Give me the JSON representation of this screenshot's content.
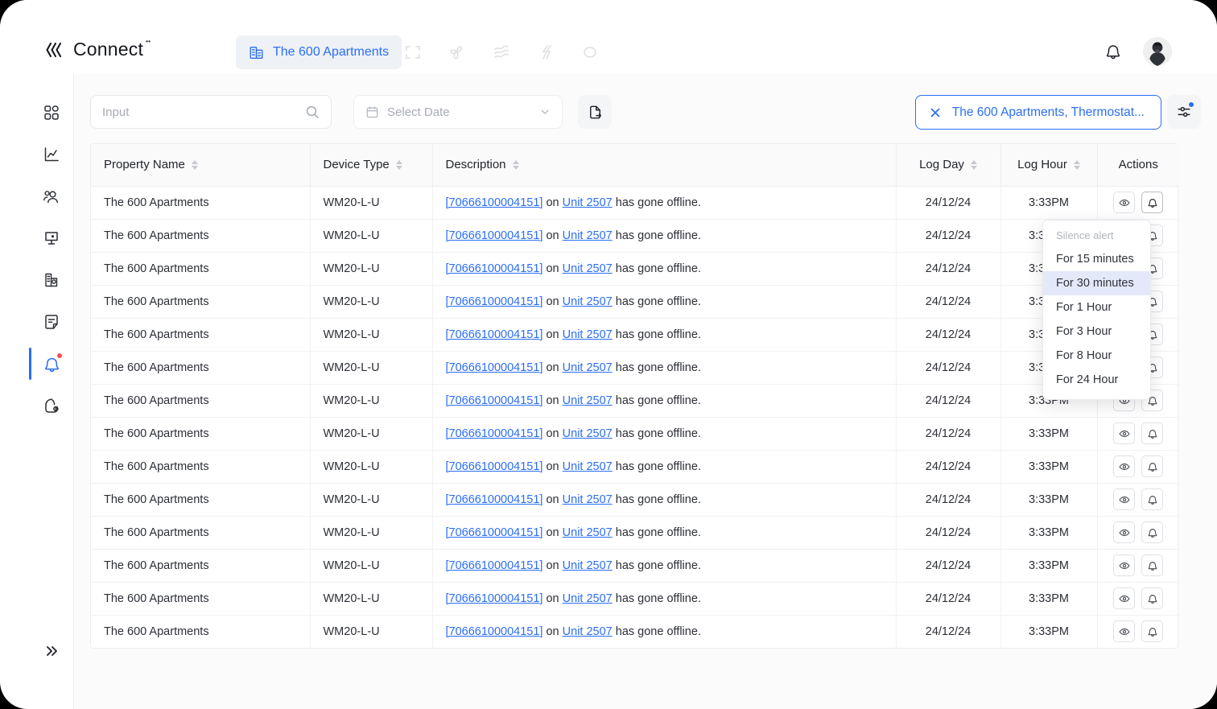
{
  "brand": {
    "name": "Connect",
    "tm": "TM"
  },
  "header": {
    "tab": {
      "label": "The 600 Apartments",
      "icon": "building-icon"
    },
    "nav_icons": [
      "expand-icon",
      "fan-icon",
      "waves-icon",
      "bolt-icon",
      "eye-shape-icon"
    ],
    "bell": "bell-icon",
    "avatar": "user-avatar"
  },
  "sidebar": {
    "items": [
      {
        "icon": "dashboard-grid-icon",
        "active": false
      },
      {
        "icon": "analytics-chart-icon",
        "active": false
      },
      {
        "icon": "users-icon",
        "active": false
      },
      {
        "icon": "monitor-device-icon",
        "active": false
      },
      {
        "icon": "building-report-icon",
        "active": false
      },
      {
        "icon": "document-note-icon",
        "active": false
      },
      {
        "icon": "bell-alert-icon",
        "active": true,
        "badge": true
      },
      {
        "icon": "billing-wallet-icon",
        "active": false
      }
    ],
    "collapse": {
      "icon": "chevron-double-right-icon"
    }
  },
  "toolbar": {
    "search": {
      "value": "",
      "placeholder": "Input",
      "icon": "search-icon"
    },
    "date": {
      "label": "Select Date",
      "icon": "calendar-icon",
      "chevron": "chevron-down-icon"
    },
    "export": {
      "icon": "export-document-icon"
    },
    "filter_chip": {
      "label": "The 600 Apartments, Thermostat...",
      "close_icon": "close-x-icon"
    },
    "settings": {
      "icon": "sliders-settings-icon",
      "badge": true
    }
  },
  "table": {
    "columns": [
      {
        "key": "property",
        "label": "Property Name",
        "sortable": true
      },
      {
        "key": "device",
        "label": "Device Type",
        "sortable": true
      },
      {
        "key": "description",
        "label": "Description",
        "sortable": true
      },
      {
        "key": "log_day",
        "label": "Log Day",
        "sortable": true
      },
      {
        "key": "log_hour",
        "label": "Log Hour",
        "sortable": true
      },
      {
        "key": "actions",
        "label": "Actions",
        "sortable": false
      }
    ],
    "row_template": {
      "property": "The 600 Apartments",
      "device": "WM20-L-U",
      "desc_id": "[70666100004151]",
      "desc_mid": " on ",
      "desc_unit": "Unit 2507",
      "desc_tail": " has gone offline.",
      "log_day": "24/12/24",
      "log_hour": "3:33PM"
    },
    "row_count": 14,
    "action_icons": {
      "view": "eye-icon",
      "silence": "bell-icon"
    }
  },
  "dropdown": {
    "title": "Silence alert",
    "items": [
      {
        "label": "For 15 minutes",
        "selected": false
      },
      {
        "label": "For  30 minutes",
        "selected": true
      },
      {
        "label": "For  1 Hour",
        "selected": false
      },
      {
        "label": "For  3 Hour",
        "selected": false
      },
      {
        "label": "For  8 Hour",
        "selected": false
      },
      {
        "label": "For  24 Hour",
        "selected": false
      }
    ]
  },
  "colors": {
    "accent": "#2b6ef6",
    "badge_red": "#fc4b4b",
    "tab_bg": "#eef1f6",
    "dropdown_selected": "#e4e9fa",
    "page_bg": "#fbfbfc"
  }
}
